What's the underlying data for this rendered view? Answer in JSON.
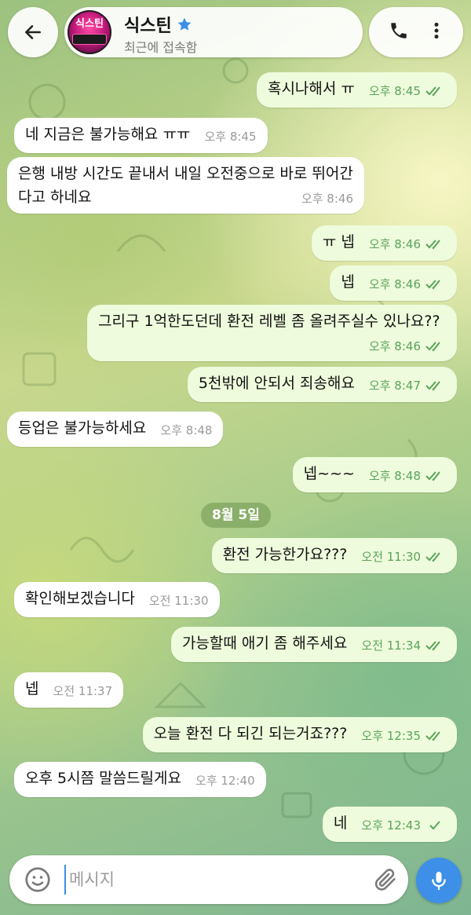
{
  "header": {
    "back_icon": "arrow-left-icon",
    "avatar_text": "식스틴",
    "chat_name": "식스틴",
    "star_icon": "star-icon",
    "status": "최근에 접속함",
    "call_icon": "phone-icon",
    "more_icon": "more-vertical-icon"
  },
  "messages": [
    {
      "side": "out",
      "text": "혹시나해서 ㅠ",
      "time": "오후 8:45",
      "status": "read"
    },
    {
      "side": "in",
      "text": "네 지금은 불가능해요 ㅠㅠ",
      "time": "오후 8:45"
    },
    {
      "side": "in",
      "text": "은행 내방 시간도 끝내서 내일 오전중으로 바로 뛰어간다고 하네요",
      "time": "오후 8:46"
    },
    {
      "side": "out",
      "text": "ㅠ 넵",
      "time": "오후 8:46",
      "status": "read"
    },
    {
      "side": "out",
      "text": "넵",
      "time": "오후 8:46",
      "status": "read"
    },
    {
      "side": "out",
      "text": "그리구 1억한도던데 환전 레벨 좀 올려주실수 있나요??",
      "time": "오후 8:46",
      "status": "read"
    },
    {
      "side": "out",
      "text": "5천밖에 안되서 죄송해요",
      "time": "오후 8:47",
      "status": "read"
    },
    {
      "side": "in",
      "text": "등업은 불가능하세요",
      "time": "오후 8:48"
    },
    {
      "side": "out",
      "text": "넵~~~",
      "time": "오후 8:48",
      "status": "read"
    },
    {
      "side": "out",
      "text": "환전 가능한가요???",
      "time": "오전 11:30",
      "status": "read"
    },
    {
      "side": "in",
      "text": "확인해보겠습니다",
      "time": "오전 11:30"
    },
    {
      "side": "out",
      "text": "가능할때 애기 좀 해주세요",
      "time": "오전 11:34",
      "status": "read"
    },
    {
      "side": "in",
      "text": "넵",
      "time": "오전 11:37"
    },
    {
      "side": "out",
      "text": "오늘 환전 다 되긴 되는거죠???",
      "time": "오후 12:35",
      "status": "read"
    },
    {
      "side": "in",
      "text": "오후 5시쯤 말씀드릴게요",
      "time": "오후 12:40"
    },
    {
      "side": "out",
      "text": "네",
      "time": "오후 12:43",
      "status": "sent"
    }
  ],
  "date_separator": "8월 5일",
  "input": {
    "placeholder": "메시지",
    "value": "",
    "emoji_icon": "emoji-icon",
    "attach_icon": "paperclip-icon",
    "mic_icon": "microphone-icon"
  },
  "colors": {
    "incoming_bubble": "#ffffff",
    "outgoing_bubble": "#eefbdc",
    "outgoing_meta": "#5aa45a",
    "accent": "#3e8fe8"
  }
}
